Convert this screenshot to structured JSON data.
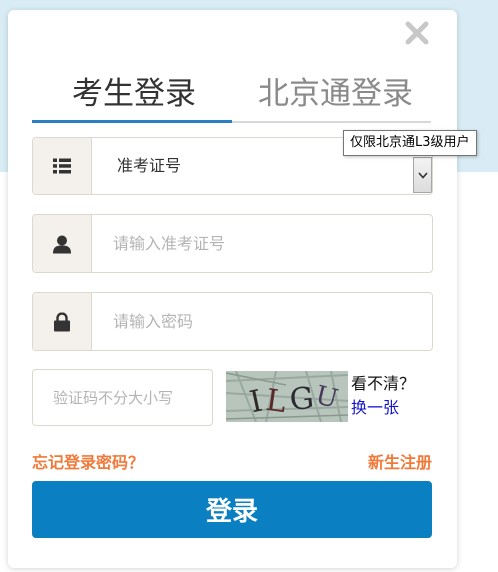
{
  "tabs": [
    {
      "label": "考生登录",
      "active": true
    },
    {
      "label": "北京通登录",
      "active": false
    }
  ],
  "tooltip": "仅限北京通L3级用户",
  "id_type_select": {
    "selected": "准考证号"
  },
  "exam_number_field": {
    "placeholder": "请输入准考证号",
    "value": ""
  },
  "password_field": {
    "placeholder": "请输入密码",
    "value": ""
  },
  "captcha": {
    "placeholder": "验证码不分大小写",
    "image_text": "ILGU",
    "hint": "看不清？",
    "refresh_label": "换一张"
  },
  "links": {
    "forgot_password": "忘记登录密码？",
    "register": "新生注册"
  },
  "login_button": "登录",
  "colors": {
    "accent_blue": "#0a7fc2",
    "tab_underline": "#2a7fc0",
    "link_orange": "#f07a3a",
    "addon_bg": "#f4f1ec"
  },
  "icons": [
    "close-icon",
    "list-icon",
    "user-icon",
    "lock-icon",
    "chevron-down-icon"
  ]
}
